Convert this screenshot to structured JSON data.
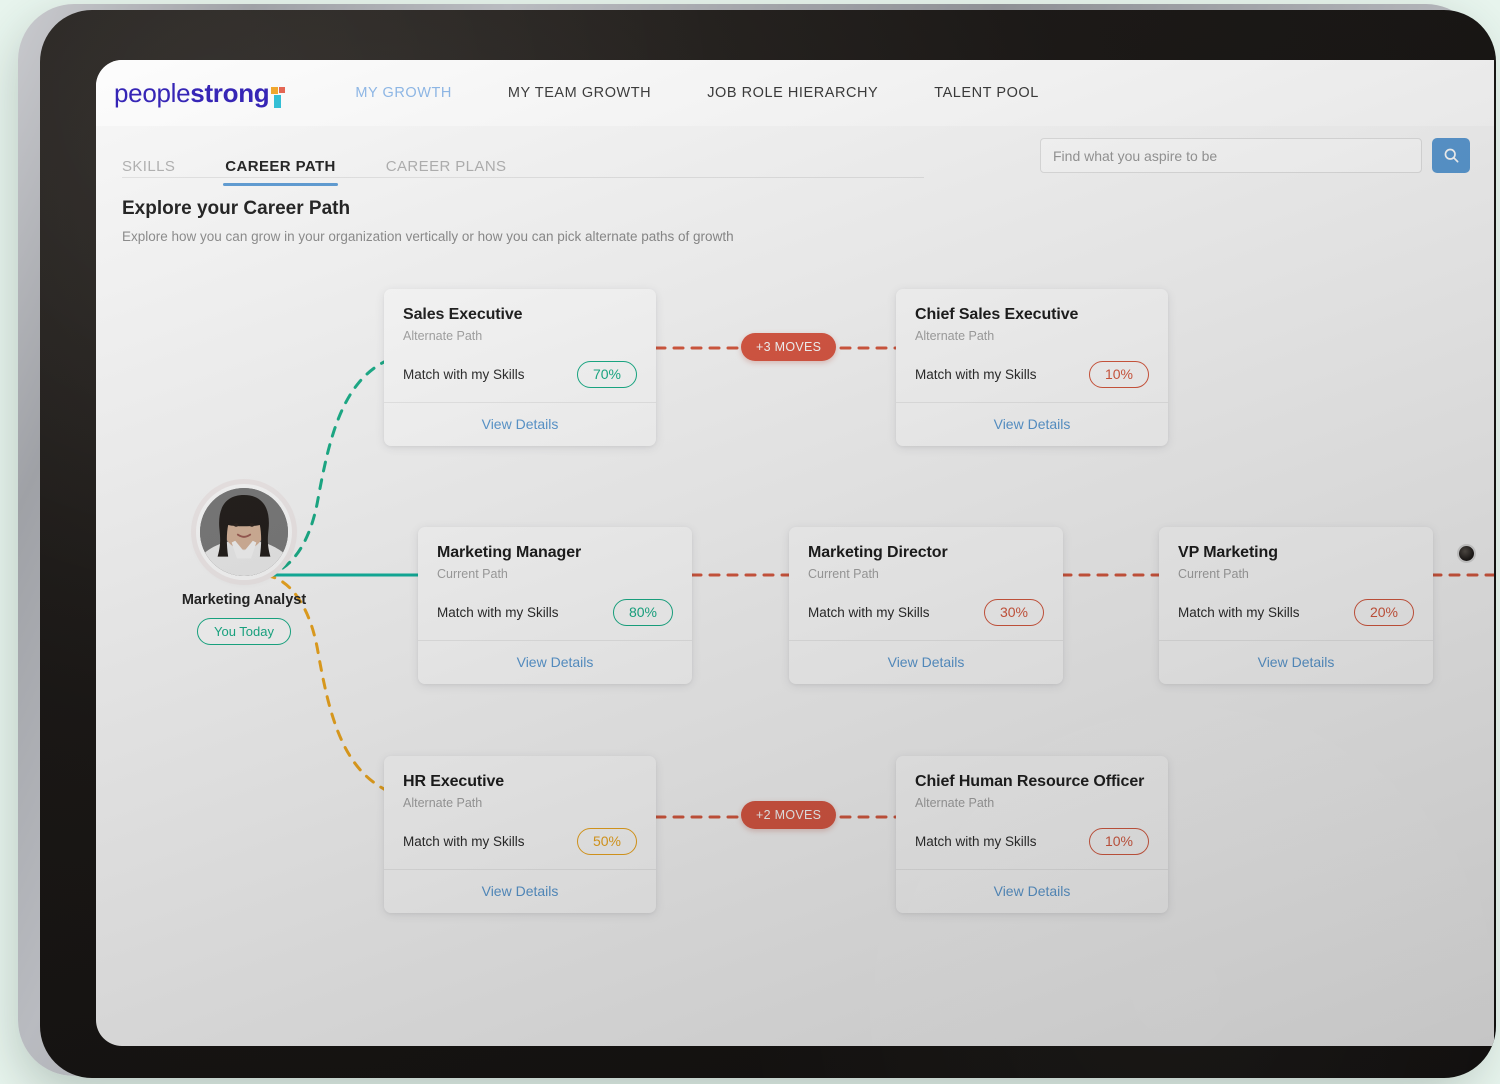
{
  "brand": {
    "name_light": "people",
    "name_bold": "strong",
    "color": "#2b19b5"
  },
  "topnav": {
    "tabs": [
      {
        "label": "MY GROWTH",
        "active": true
      },
      {
        "label": "MY TEAM GROWTH",
        "active": false
      },
      {
        "label": "JOB ROLE HIERARCHY",
        "active": false
      },
      {
        "label": "TALENT POOL",
        "active": false
      }
    ],
    "active_color": "#8cb8ea"
  },
  "subnav": {
    "tabs": [
      {
        "label": "SKILLS",
        "active": false
      },
      {
        "label": "CAREER PATH",
        "active": true
      },
      {
        "label": "CAREER PLANS",
        "active": false
      }
    ],
    "underline_color": "#5b9bd5"
  },
  "search": {
    "placeholder": "Find what you aspire to be",
    "value": "",
    "icon": "search-icon",
    "button_color": "#5b9bd5"
  },
  "page": {
    "title": "Explore your Career Path",
    "subtitle": "Explore how you can grow in your organization vertically or how you can pick alternate paths of growth"
  },
  "current_user": {
    "role": "Marketing Analyst",
    "badge": "You Today",
    "badge_color": "#18b089"
  },
  "card_labels": {
    "match_label": "Match with my Skills",
    "action": "View Details"
  },
  "cards": {
    "sales_executive": {
      "title": "Sales Executive",
      "path_type": "Alternate Path",
      "match_label": "Match with my Skills",
      "match_value": "70%",
      "match_color": "#18b089",
      "action": "View Details"
    },
    "chief_sales_executive": {
      "title": "Chief Sales Executive",
      "path_type": "Alternate Path",
      "match_label": "Match with my Skills",
      "match_value": "10%",
      "match_color": "#d9593f",
      "action": "View Details"
    },
    "marketing_manager": {
      "title": "Marketing Manager",
      "path_type": "Current Path",
      "match_label": "Match with my Skills",
      "match_value": "80%",
      "match_color": "#18b089",
      "action": "View Details"
    },
    "marketing_director": {
      "title": "Marketing Director",
      "path_type": "Current Path",
      "match_label": "Match with my Skills",
      "match_value": "30%",
      "match_color": "#d9593f",
      "action": "View Details"
    },
    "vp_marketing": {
      "title": "VP Marketing",
      "path_type": "Current Path",
      "match_label": "Match with my Skills",
      "match_value": "20%",
      "match_color": "#d9593f",
      "action": "View Details"
    },
    "hr_executive": {
      "title": "HR Executive",
      "path_type": "Alternate Path",
      "match_label": "Match with my Skills",
      "match_value": "50%",
      "match_color": "#f0a81e",
      "action": "View Details"
    },
    "chief_human_resource_officer": {
      "title": "Chief Human Resource Officer",
      "path_type": "Alternate Path",
      "match_label": "Match with my Skills",
      "match_value": "10%",
      "match_color": "#d9593f",
      "action": "View Details"
    }
  },
  "connectors": {
    "moves_top": "+3 MOVES",
    "moves_bottom": "+2 MOVES",
    "moves_color": "#dd5843",
    "alternate_up_color": "#18b089",
    "alternate_down_color": "#f0a81e",
    "current_color": "#11b5a0",
    "next_step_color": "#d9593f"
  }
}
